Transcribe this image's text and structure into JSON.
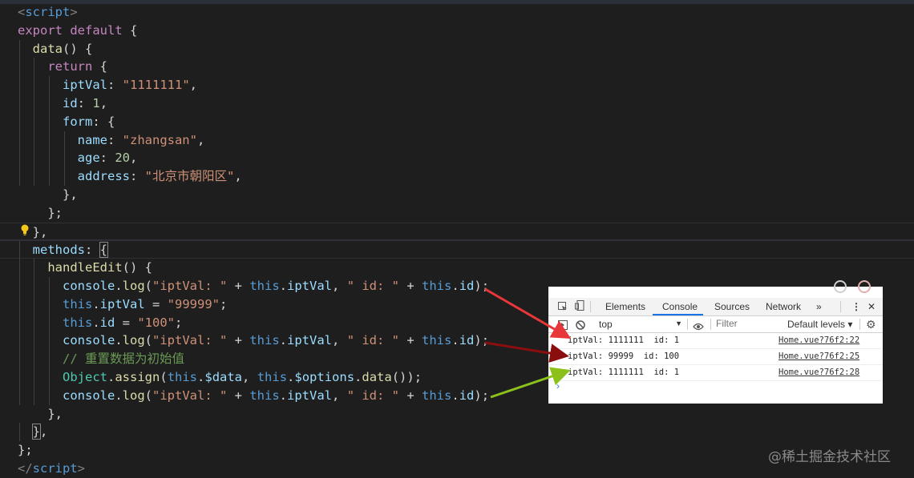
{
  "editor": {
    "lines": [
      [
        [
          "tag",
          "<"
        ],
        [
          "tagn",
          "script"
        ],
        [
          "tag",
          ">"
        ]
      ],
      [
        [
          "kw",
          "export"
        ],
        [
          "p",
          " "
        ],
        [
          "kw",
          "default"
        ],
        [
          "p",
          " {"
        ]
      ],
      [
        [
          "p",
          "  "
        ],
        [
          "fn",
          "data"
        ],
        [
          "p",
          "() {"
        ]
      ],
      [
        [
          "p",
          "    "
        ],
        [
          "kw",
          "return"
        ],
        [
          "p",
          " {"
        ]
      ],
      [
        [
          "p",
          "      "
        ],
        [
          "prop",
          "iptVal"
        ],
        [
          "p",
          ": "
        ],
        [
          "str",
          "\"1111111\""
        ],
        [
          "p",
          ","
        ]
      ],
      [
        [
          "p",
          "      "
        ],
        [
          "prop",
          "id"
        ],
        [
          "p",
          ": "
        ],
        [
          "num",
          "1"
        ],
        [
          "p",
          ","
        ]
      ],
      [
        [
          "p",
          "      "
        ],
        [
          "prop",
          "form"
        ],
        [
          "p",
          ": {"
        ]
      ],
      [
        [
          "p",
          "        "
        ],
        [
          "prop",
          "name"
        ],
        [
          "p",
          ": "
        ],
        [
          "str",
          "\"zhangsan\""
        ],
        [
          "p",
          ","
        ]
      ],
      [
        [
          "p",
          "        "
        ],
        [
          "prop",
          "age"
        ],
        [
          "p",
          ": "
        ],
        [
          "num",
          "20"
        ],
        [
          "p",
          ","
        ]
      ],
      [
        [
          "p",
          "        "
        ],
        [
          "prop",
          "address"
        ],
        [
          "p",
          ": "
        ],
        [
          "str",
          "\"北京市朝阳区\""
        ],
        [
          "p",
          ","
        ]
      ],
      [
        [
          "p",
          "      },"
        ]
      ],
      [
        [
          "p",
          "    };"
        ]
      ],
      [
        [
          "p",
          "  },"
        ]
      ],
      [
        [
          "p",
          "  "
        ],
        [
          "prop",
          "methods"
        ],
        [
          "p",
          ": "
        ],
        [
          "brk",
          "{"
        ]
      ],
      [
        [
          "p",
          "    "
        ],
        [
          "fn",
          "handleEdit"
        ],
        [
          "p",
          "() {"
        ]
      ],
      [
        [
          "p",
          "      "
        ],
        [
          "prop",
          "console"
        ],
        [
          "p",
          "."
        ],
        [
          "fn",
          "log"
        ],
        [
          "p",
          "("
        ],
        [
          "str",
          "\"iptVal: \""
        ],
        [
          "p",
          " + "
        ],
        [
          "kwb",
          "this"
        ],
        [
          "p",
          "."
        ],
        [
          "prop",
          "iptVal"
        ],
        [
          "p",
          ", "
        ],
        [
          "str",
          "\" id: \""
        ],
        [
          "p",
          " + "
        ],
        [
          "kwb",
          "this"
        ],
        [
          "p",
          "."
        ],
        [
          "prop",
          "id"
        ],
        [
          "p",
          ");"
        ]
      ],
      [
        [
          "p",
          "      "
        ],
        [
          "kwb",
          "this"
        ],
        [
          "p",
          "."
        ],
        [
          "prop",
          "iptVal"
        ],
        [
          "p",
          " = "
        ],
        [
          "str",
          "\"99999\""
        ],
        [
          "p",
          ";"
        ]
      ],
      [
        [
          "p",
          "      "
        ],
        [
          "kwb",
          "this"
        ],
        [
          "p",
          "."
        ],
        [
          "prop",
          "id"
        ],
        [
          "p",
          " = "
        ],
        [
          "str",
          "\"100\""
        ],
        [
          "p",
          ";"
        ]
      ],
      [
        [
          "p",
          "      "
        ],
        [
          "prop",
          "console"
        ],
        [
          "p",
          "."
        ],
        [
          "fn",
          "log"
        ],
        [
          "p",
          "("
        ],
        [
          "str",
          "\"iptVal: \""
        ],
        [
          "p",
          " + "
        ],
        [
          "kwb",
          "this"
        ],
        [
          "p",
          "."
        ],
        [
          "prop",
          "iptVal"
        ],
        [
          "p",
          ", "
        ],
        [
          "str",
          "\" id: \""
        ],
        [
          "p",
          " + "
        ],
        [
          "kwb",
          "this"
        ],
        [
          "p",
          "."
        ],
        [
          "prop",
          "id"
        ],
        [
          "p",
          ");"
        ]
      ],
      [
        [
          "p",
          "      "
        ],
        [
          "cmt",
          "// 重置数据为初始值"
        ]
      ],
      [
        [
          "p",
          "      "
        ],
        [
          "obj",
          "Object"
        ],
        [
          "p",
          "."
        ],
        [
          "fn",
          "assign"
        ],
        [
          "p",
          "("
        ],
        [
          "kwb",
          "this"
        ],
        [
          "p",
          "."
        ],
        [
          "prop",
          "$data"
        ],
        [
          "p",
          ", "
        ],
        [
          "kwb",
          "this"
        ],
        [
          "p",
          "."
        ],
        [
          "prop",
          "$options"
        ],
        [
          "p",
          "."
        ],
        [
          "fn",
          "data"
        ],
        [
          "p",
          "());"
        ]
      ],
      [
        [
          "p",
          "      "
        ],
        [
          "prop",
          "console"
        ],
        [
          "p",
          "."
        ],
        [
          "fn",
          "log"
        ],
        [
          "p",
          "("
        ],
        [
          "str",
          "\"iptVal: \""
        ],
        [
          "p",
          " + "
        ],
        [
          "kwb",
          "this"
        ],
        [
          "p",
          "."
        ],
        [
          "prop",
          "iptVal"
        ],
        [
          "p",
          ", "
        ],
        [
          "str",
          "\" id: \""
        ],
        [
          "p",
          " + "
        ],
        [
          "kwb",
          "this"
        ],
        [
          "p",
          "."
        ],
        [
          "prop",
          "id"
        ],
        [
          "p",
          ");"
        ]
      ],
      [
        [
          "p",
          "    },"
        ]
      ],
      [
        [
          "p",
          "  "
        ],
        [
          "brk",
          "}"
        ],
        [
          "p",
          ","
        ]
      ],
      [
        [
          "p",
          "};"
        ]
      ],
      [
        [
          "tag",
          "</"
        ],
        [
          "tagn",
          "script"
        ],
        [
          "tag",
          ">"
        ]
      ]
    ]
  },
  "devtools": {
    "tabs": [
      "Elements",
      "Console",
      "Sources",
      "Network",
      "»"
    ],
    "active_tab": "Console",
    "context": "top",
    "filter_placeholder": "Filter",
    "levels": "Default levels ▾",
    "rows": [
      {
        "message": "iptVal: 1111111  id: 1",
        "source": "Home.vue?76f2:22"
      },
      {
        "message": "iptVal: 99999  id: 100",
        "source": "Home.vue?76f2:25"
      },
      {
        "message": "iptVal: 1111111  id: 1",
        "source": "Home.vue?76f2:28"
      }
    ],
    "prompt": "›"
  },
  "arrows": {
    "colors": [
      "#e8373a",
      "#8b0e0e",
      "#8cc11c"
    ]
  },
  "watermark": "@稀土掘金技术社区"
}
